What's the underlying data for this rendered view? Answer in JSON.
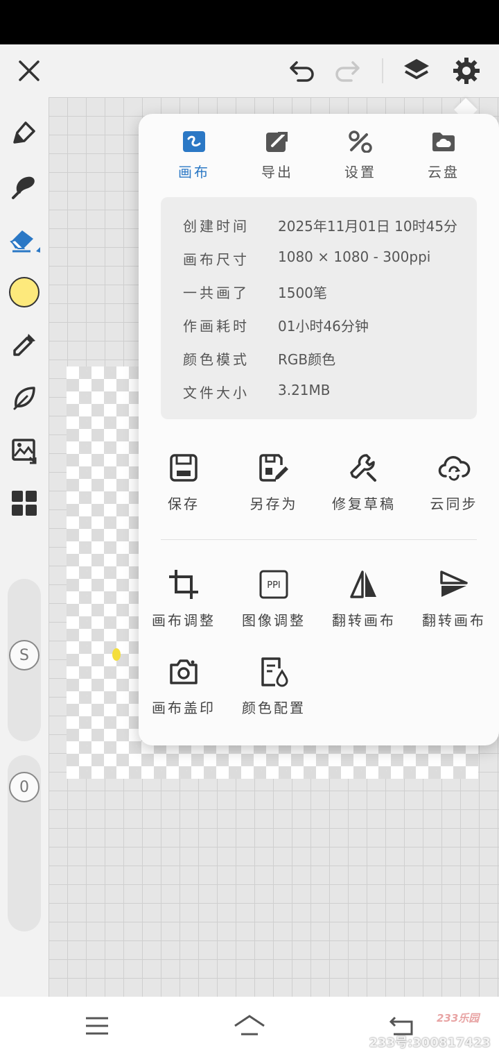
{
  "toolbar": {
    "close_icon": "close-icon",
    "undo_icon": "undo-icon",
    "redo_icon": "redo-icon",
    "layers_icon": "layers-icon",
    "settings_icon": "gear-icon"
  },
  "left_tools": {
    "items": [
      "pencil-icon",
      "brush-icon",
      "eraser-icon",
      "color-swatch",
      "eyedropper-icon",
      "leaf-icon",
      "image-import-icon",
      "grid-icon"
    ],
    "current_color": "#fde97c",
    "size_label": "S",
    "opacity_label": "0"
  },
  "popup": {
    "tabs": [
      {
        "label": "画布",
        "icon": "canvas-icon",
        "active": true
      },
      {
        "label": "导出",
        "icon": "export-icon",
        "active": false
      },
      {
        "label": "设置",
        "icon": "tools-icon",
        "active": false
      },
      {
        "label": "云盘",
        "icon": "cloud-folder-icon",
        "active": false
      }
    ],
    "info": [
      {
        "key": "创建时间",
        "value": "2025年11月01日 10时45分"
      },
      {
        "key": "画布尺寸",
        "value": "1080 × 1080 - 300ppi"
      },
      {
        "key": "一共画了",
        "value": "1500笔"
      },
      {
        "key": "作画耗时",
        "value": "01小时46分钟"
      },
      {
        "key": "颜色模式",
        "value": "RGB颜色"
      },
      {
        "key": "文件大小",
        "value": "3.21MB"
      }
    ],
    "actions_primary": [
      {
        "label": "保存",
        "icon": "save-icon"
      },
      {
        "label": "另存为",
        "icon": "save-as-icon"
      },
      {
        "label": "修复草稿",
        "icon": "wrench-icon"
      },
      {
        "label": "云同步",
        "icon": "cloud-sync-icon"
      }
    ],
    "actions_secondary": [
      {
        "label": "画布调整",
        "icon": "crop-icon"
      },
      {
        "label": "图像调整",
        "icon": "ppi-icon",
        "icon_text": "PPI"
      },
      {
        "label": "翻转画布",
        "icon": "flip-horizontal-icon"
      },
      {
        "label": "翻转画布",
        "icon": "flip-vertical-icon"
      },
      {
        "label": "画布盖印",
        "icon": "camera-icon"
      },
      {
        "label": "颜色配置",
        "icon": "color-profile-icon"
      }
    ]
  },
  "nav": {
    "menu_icon": "menu-icon",
    "home_icon": "home-icon",
    "back_icon": "back-icon"
  },
  "watermark": {
    "logo": "233乐园",
    "id_text": "233号:300817423"
  },
  "colors": {
    "accent": "#2b78c5",
    "icon_dark": "#333333",
    "panel": "#fbfbfb"
  }
}
